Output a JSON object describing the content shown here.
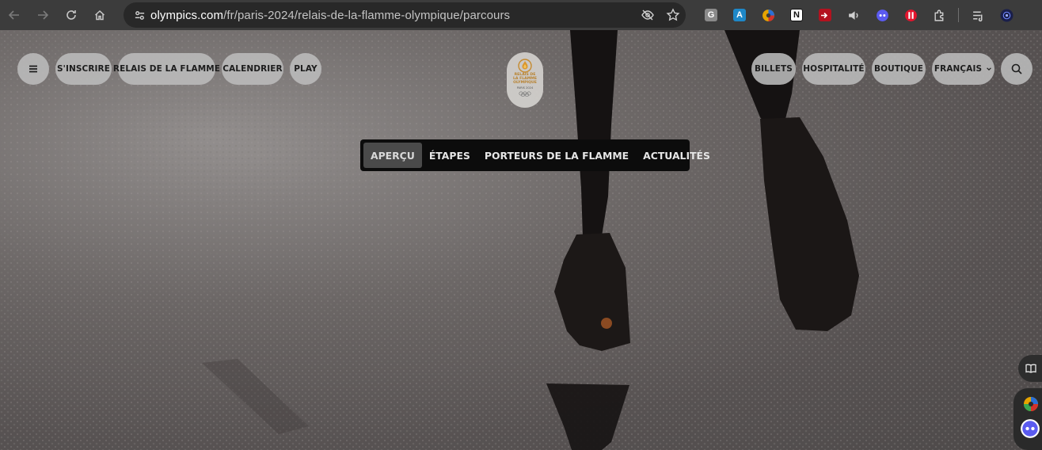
{
  "browser": {
    "url_host": "olympics.com",
    "url_path": "/fr/paris-2024/relais-de-la-flamme-olympique/parcours",
    "extensions": [
      {
        "name": "G",
        "label": "G",
        "color": "#8a8a8a"
      },
      {
        "name": "translate",
        "label": "A",
        "color": "#1e88c8"
      },
      {
        "name": "color-picker",
        "label": "",
        "color": "#e6a400"
      },
      {
        "name": "notion",
        "label": "N",
        "color": "#ffffff"
      },
      {
        "name": "screen-recorder",
        "label": "",
        "color": "#b3121f"
      },
      {
        "name": "audio",
        "label": "",
        "color": "#cfcfcf"
      },
      {
        "name": "assistant",
        "label": "",
        "color": "#5b5bf0"
      },
      {
        "name": "pocket",
        "label": "",
        "color": "#e3142d"
      }
    ]
  },
  "header": {
    "left": {
      "menu_label": "menu",
      "items": [
        "S'INSCRIRE",
        "RELAIS DE LA FLAMME",
        "CALENDRIER",
        "PLAY"
      ]
    },
    "logo": {
      "line1": "RELAIS DE",
      "line2": "LA FLAMME",
      "line3": "OLYMPIQUE",
      "sub": "PARIS 2024"
    },
    "right": {
      "items": [
        "BILLETS",
        "HOSPITALITÉ",
        "BOUTIQUE"
      ],
      "language": "FRANÇAIS"
    }
  },
  "subnav": {
    "tabs": [
      "APERÇU",
      "ÉTAPES",
      "PORTEURS DE LA FLAMME",
      "ACTUALITÉS"
    ],
    "active": "APERÇU"
  },
  "colors": {
    "chrome_bg": "#3c3c3c",
    "omnibox_bg": "#282828",
    "pill_bg": "#bcbcbc",
    "subnav_bg": "#0c0c0c",
    "logo_gold": "#b8812d"
  }
}
